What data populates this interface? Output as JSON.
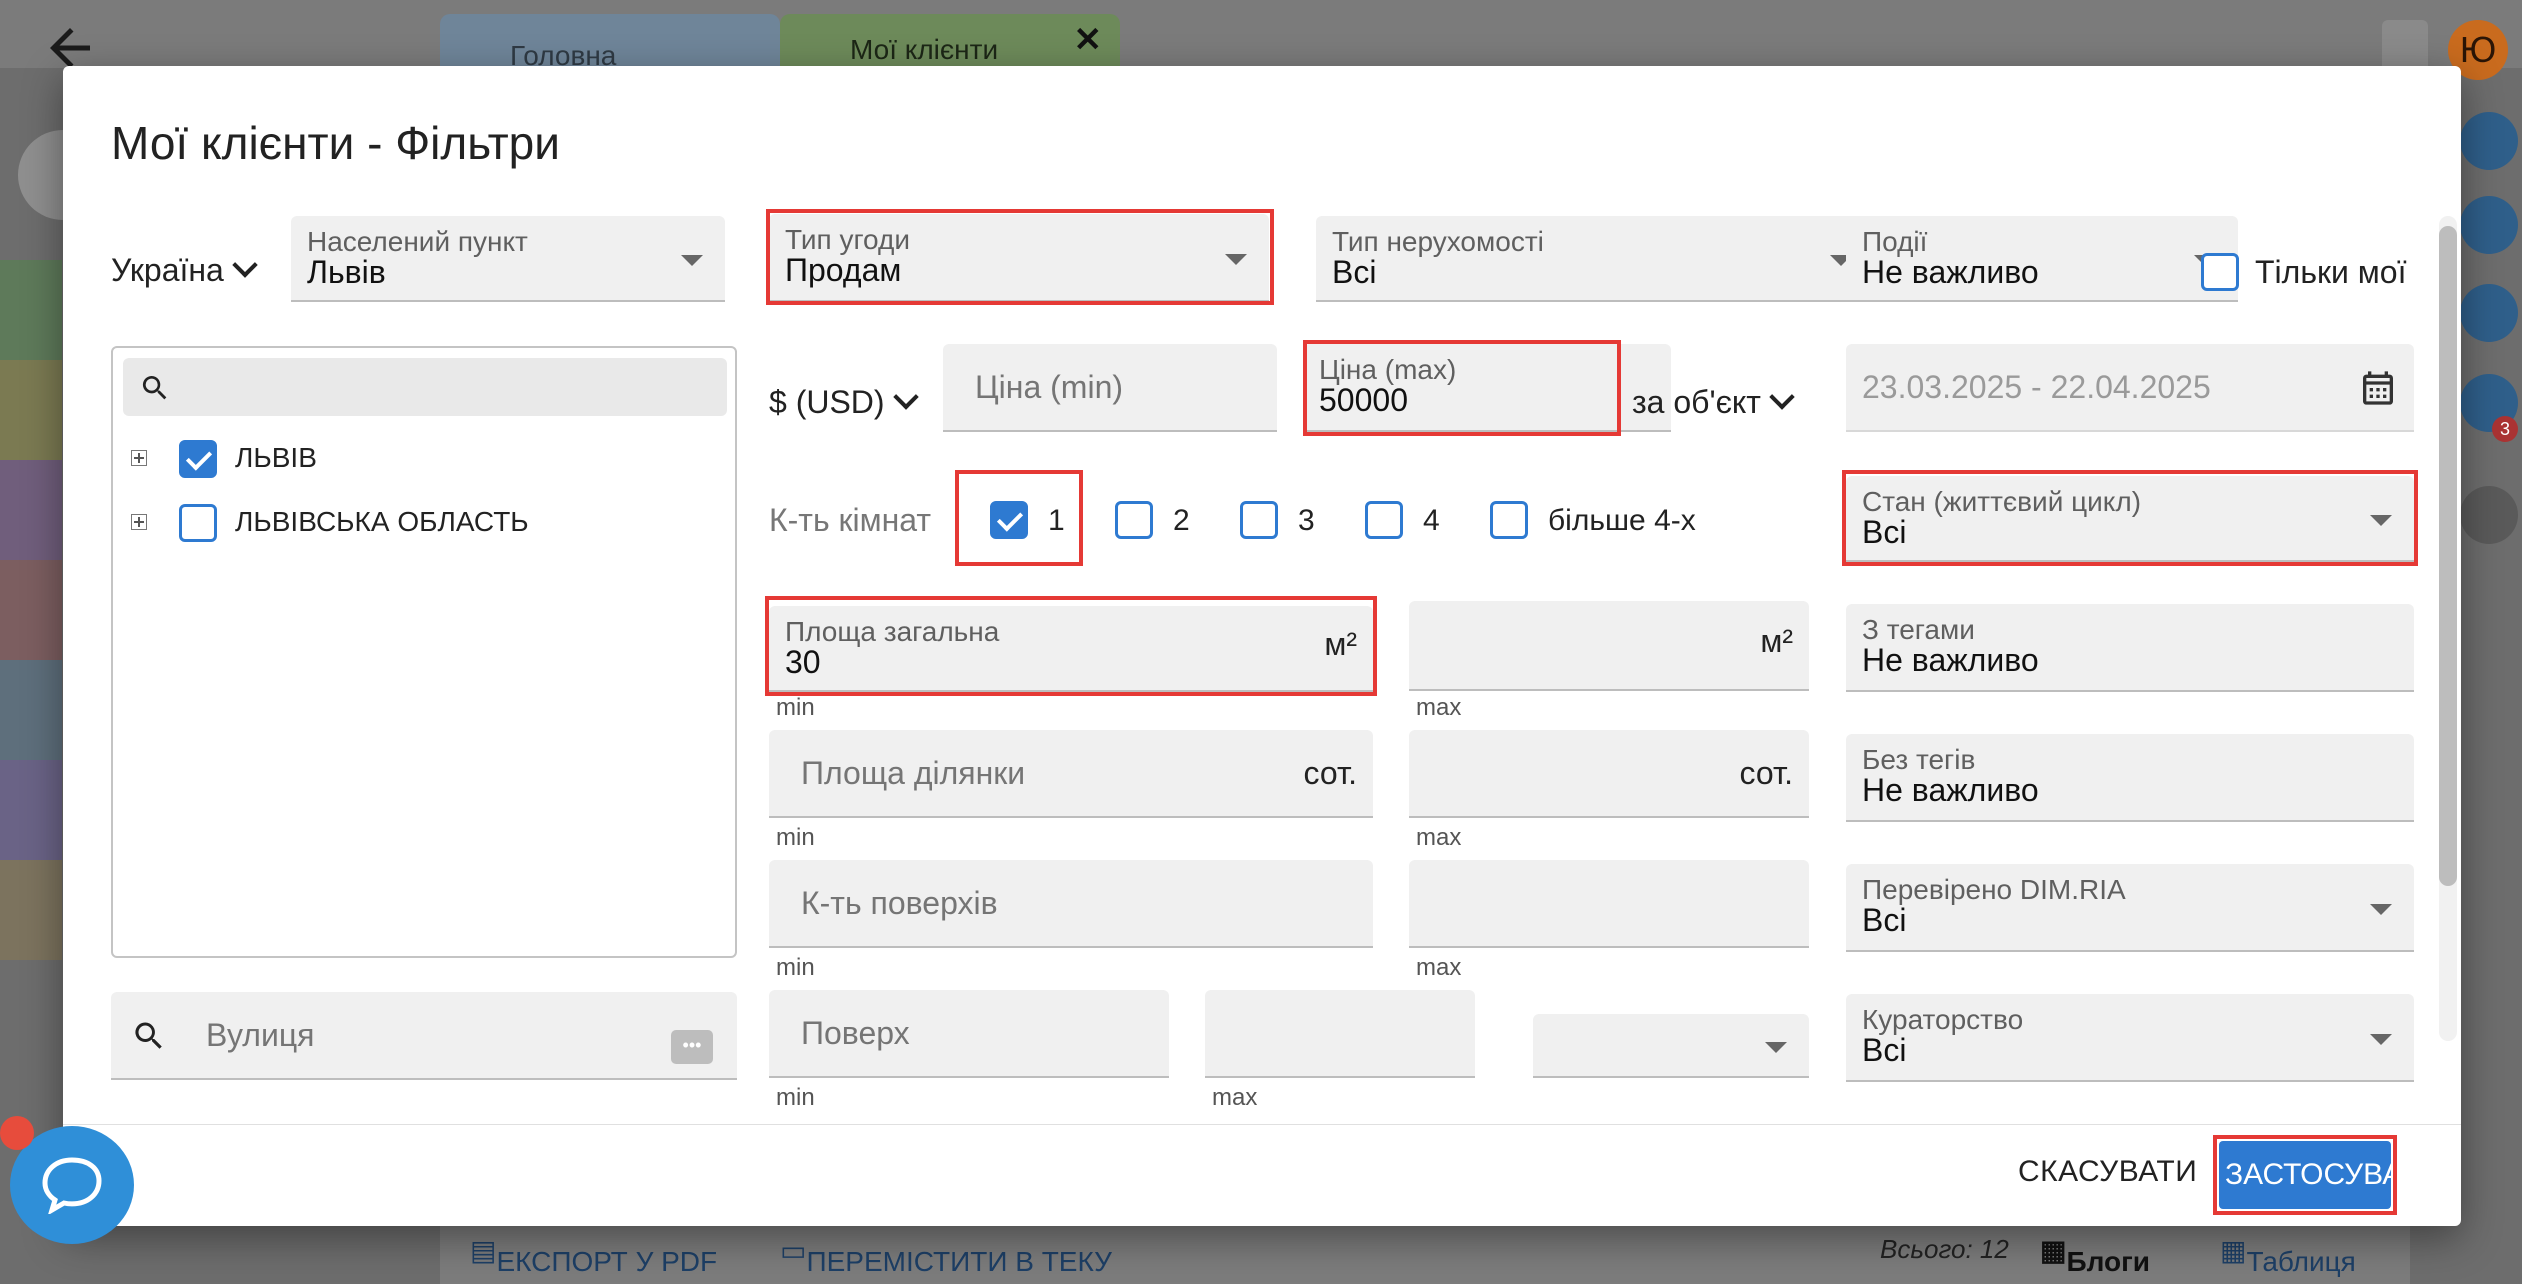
{
  "background": {
    "tabs": [
      {
        "label": "Головна"
      },
      {
        "label": "Мої клієнти",
        "close": "✕"
      }
    ],
    "avatar_letter": "Ю",
    "notification_count": "3",
    "bottom_bar": {
      "export_pdf": "ЕКСПОРТ У PDF",
      "move_to_folder": "ПЕРЕМІСТИТИ В ТЕКУ",
      "total": "Всього: 12",
      "blogs": "Блоги",
      "table": "Таблиця"
    }
  },
  "modal": {
    "title": "Мої клієнти - Фільтри",
    "country": "Україна",
    "settlement": {
      "label": "Населений пункт",
      "value": "Львів"
    },
    "deal_type": {
      "label": "Тип угоди",
      "value": "Продам"
    },
    "property_type": {
      "label": "Тип нерухомості",
      "value": "Всі"
    },
    "events": {
      "label": "Події",
      "value": "Не важливо"
    },
    "only_mine": {
      "label": "Тільки мої",
      "checked": false
    },
    "tree": {
      "search_placeholder": "",
      "items": [
        {
          "label": "ЛЬВІВ",
          "checked": true
        },
        {
          "label": "ЛЬВІВСЬКА ОБЛАСТЬ",
          "checked": false
        }
      ]
    },
    "currency": "$ (USD)",
    "price_min": {
      "placeholder": "Ціна (min)"
    },
    "price_max": {
      "label": "Ціна (max)",
      "value": "50000"
    },
    "price_per": "за об'єкт",
    "date_range": "23.03.2025 - 22.04.2025",
    "rooms": {
      "label": "К-ть кімнат",
      "options": [
        {
          "label": "1",
          "checked": true
        },
        {
          "label": "2",
          "checked": false
        },
        {
          "label": "3",
          "checked": false
        },
        {
          "label": "4",
          "checked": false
        },
        {
          "label": "більше 4-х",
          "checked": false
        }
      ]
    },
    "lifecycle": {
      "label": "Стан (життєвий цикл)",
      "value": "Всі"
    },
    "total_area": {
      "label": "Площа загальна",
      "value": "30",
      "unit": "м²",
      "min_label": "min"
    },
    "total_area_max": {
      "unit": "м²",
      "max_label": "max"
    },
    "with_tags": {
      "label": "З тегами",
      "value": "Не важливо"
    },
    "plot_area": {
      "placeholder": "Площа ділянки",
      "unit": "сот.",
      "min_label": "min"
    },
    "plot_area_max": {
      "unit": "сот.",
      "max_label": "max"
    },
    "without_tags": {
      "label": "Без тегів",
      "value": "Не важливо"
    },
    "floors_count": {
      "placeholder": "К-ть поверхів",
      "min_label": "min"
    },
    "floors_count_max": {
      "max_label": "max"
    },
    "verified": {
      "label": "Перевірено DIM.RIA",
      "value": "Всі"
    },
    "street": {
      "placeholder": "Вулиця"
    },
    "floor": {
      "placeholder": "Поверх",
      "min_label": "min"
    },
    "floor_max": {
      "max_label": "max"
    },
    "curatorship": {
      "label": "Кураторство",
      "value": "Всі"
    },
    "cancel": "СКАСУВАТИ",
    "apply": "ЗАСТОСУВАТИ"
  },
  "colors": {
    "accent": "#2e7ad1",
    "highlight": "#e53935",
    "chat": "#2f8fd8"
  }
}
